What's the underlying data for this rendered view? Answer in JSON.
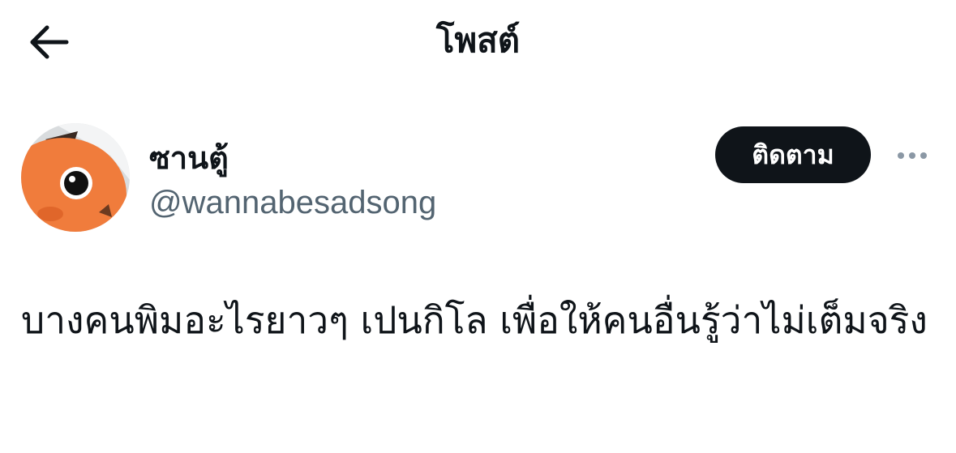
{
  "header": {
    "title": "โพสต์",
    "back_icon": "arrow-left-icon"
  },
  "author": {
    "display_name": "ซานตู้",
    "handle": "@wannabesadsong",
    "avatar_icon": "orange-fish-avatar",
    "follow_label": "ติดตาม",
    "more_icon": "more-horizontal-icon"
  },
  "post": {
    "text": "บางคนพิมอะไรยาวๆ เปนกิโล เพื่อให้คนอื่นรู้ว่าไม่เต็มจริง"
  },
  "colors": {
    "text_primary": "#0f1419",
    "text_secondary": "#536471",
    "button_bg": "#0f1419",
    "avatar_orange": "#f07c3c"
  }
}
